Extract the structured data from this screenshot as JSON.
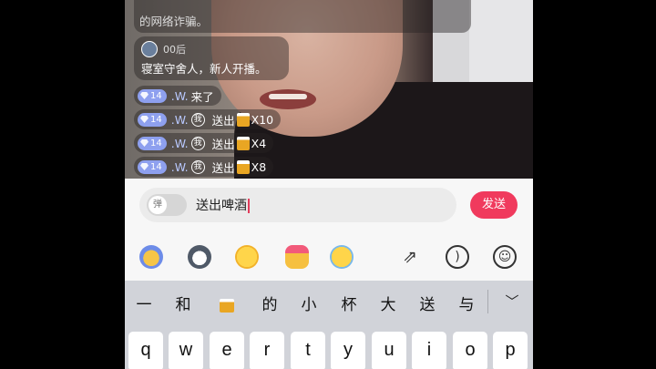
{
  "chat": {
    "top_message": "的网络诈骗。",
    "intro": {
      "user": "00后",
      "text": "寝室守舍人，新人开播。"
    },
    "messages": [
      {
        "level": "14",
        "user": ".W.",
        "me": "",
        "text": "来了",
        "gift": false,
        "count": ""
      },
      {
        "level": "14",
        "user": ".W.",
        "me": "我",
        "text": "送出",
        "gift": true,
        "count": "X10"
      },
      {
        "level": "14",
        "user": ".W.",
        "me": "我",
        "text": "送出",
        "gift": true,
        "count": "X4"
      },
      {
        "level": "14",
        "user": ".W.",
        "me": "我",
        "text": "送出",
        "gift": true,
        "count": "X8"
      }
    ]
  },
  "input": {
    "danmu_toggle_label": "弹",
    "value": "送出啤酒",
    "send_label": "发送"
  },
  "emoji_row": {
    "emojis": [
      "cat-face-icon",
      "husky-dog-icon",
      "rolling-laughing-icon",
      "love-hands-icon",
      "crying-face-icon"
    ],
    "tools": [
      "share-icon",
      "voice-icon",
      "emoji-keyboard-icon"
    ]
  },
  "keyboard": {
    "candidates": [
      "一",
      "和",
      "的",
      "小",
      "杯",
      "大",
      "送",
      "与"
    ],
    "candidate_emoji": "beer-mug-icon",
    "collapse_icon": "chevron-down-icon",
    "row1": [
      "q",
      "w",
      "e",
      "r",
      "t",
      "y",
      "u",
      "i",
      "o",
      "p"
    ]
  },
  "colors": {
    "accent": "#f03a5d",
    "badge": "#8ea0ef",
    "keyboard_bg": "#d1d3d9"
  }
}
